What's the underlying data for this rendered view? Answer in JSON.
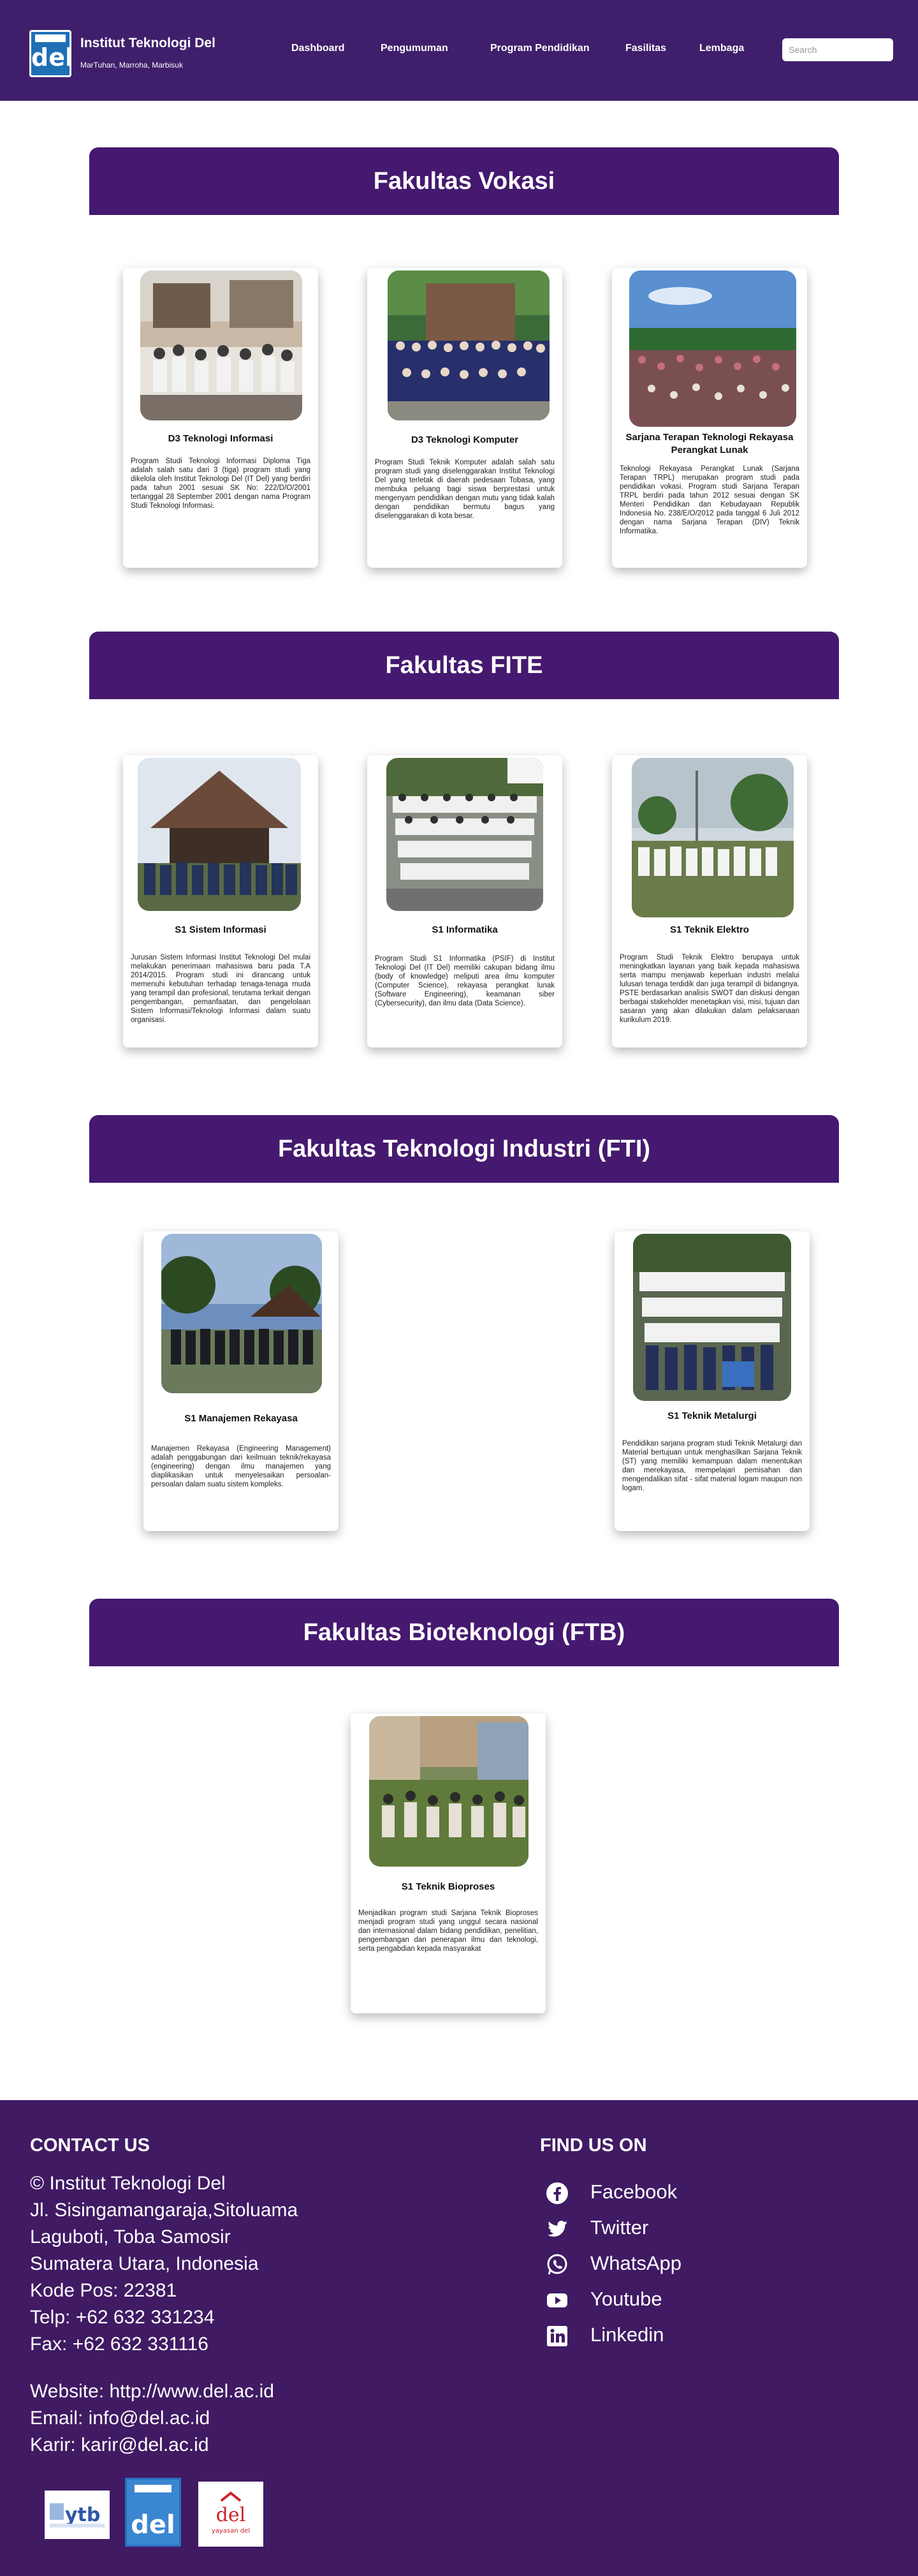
{
  "header": {
    "logo_text": "del",
    "title": "Institut Teknologi Del",
    "subtitle": "MarTuhan, Marroha, Marbisuk",
    "nav": [
      "Dashboard",
      "Pengumuman",
      "Program Pendidikan",
      "Fasilitas",
      "Lembaga"
    ],
    "search_placeholder": "Search"
  },
  "faculties": [
    {
      "name": "Fakultas Vokasi",
      "programs": [
        {
          "title": "D3 Teknologi Informasi",
          "description": "Program Studi Teknologi Informasi Diploma Tiga adalah salah satu dari 3 (tiga) program studi yang dikelola oleh Institut Teknologi Del (IT Del) yang berdiri pada tahun 2001 sesuai SK No: 222/D/O/2001 tertanggal 28 September 2001 dengan nama Program Studi Teknologi Informasi."
        },
        {
          "title": "D3 Teknologi Komputer",
          "description": "Program Studi Teknik Komputer adalah salah satu program studi yang diselenggarakan Institut Teknologi Del yang terletak di daerah pedesaan Tobasa, yang membuka peluang bagi siswa berprestasi untuk mengenyam pendidikan dengan mutu yang tidak kalah dengan pendidikan bermutu bagus yang diselenggarakan di kota besar."
        },
        {
          "title": "Sarjana Terapan Teknologi Rekayasa Perangkat Lunak",
          "description": "Teknologi Rekayasa Perangkat Lunak (Sarjana Terapan TRPL) merupakan program studi pada pendidikan vokasi. Program studi Sarjana Terapan TRPL berdiri pada tahun 2012 sesuai dengan SK Menteri Pendidikan dan Kebudayaan Republik Indonesia No. 238/E/O/2012 pada tanggal 6 Juli 2012 dengan nama Sarjana Terapan (DIV) Teknik Informatika."
        }
      ]
    },
    {
      "name": "Fakultas FITE",
      "programs": [
        {
          "title": "S1 Sistem Informasi",
          "description": "Jurusan Sistem Informasi Institut Teknologi Del mulai melakukan penerimaan mahasiswa baru pada T.A 2014/2015. Program studi ini dirancang untuk memenuhi kebutuhan terhadap tenaga-tenaga muda yang terampil dan profesional, terutama terkait dengan pengembangan, pemanfaatan, dan pengelolaan Sistem Informasi/Teknologi Informasi dalam suatu organisasi."
        },
        {
          "title": "S1 Informatika",
          "description": "Program Studi S1 Informatika (PSIF) di Institut Teknologi Del (IT Del) memiliki cakupan bidang ilmu (body of knowledge) meliputi area ilmu komputer (Computer Science), rekayasa perangkat lunak (Software Engineering), keamanan siber (Cybersecurity), dan ilmu data (Data Science)."
        },
        {
          "title": "S1 Teknik Elektro",
          "description": "Program Studi Teknik Elektro berupaya untuk meningkatkan layanan yang baik kepada mahasiswa serta mampu menjawab keperluan industri melalui lulusan tenaga terdidik dan juga terampil di bidangnya. PSTE berdasarkan analisis SWOT dan diskusi dengan berbagai stakeholder menetapkan visi, misi, tujuan dan sasaran yang akan dilakukan dalam pelaksanaan kurikulum 2019."
        }
      ]
    },
    {
      "name": "Fakultas Teknologi Industri (FTI)",
      "programs": [
        {
          "title": "S1 Manajemen Rekayasa",
          "description": "Manajemen Rekayasa (Engineering Management) adalah penggabungan dari keilmuan teknik/rekayasa (engineering) dengan ilmu manajemen yang diaplikasikan untuk menyelesaikan persoalan-persoalan dalam suatu sistem kompleks."
        },
        {
          "title": "S1 Teknik Metalurgi",
          "description": "Pendidikan sarjana program studi Teknik Metalurgi dan Material bertujuan untuk menghasilkan Sarjana Teknik (ST) yang memiliki kemampuan dalam menentukan dan merekayasa, mempelajari pemisahan dan mengendalikan sifat - sifat material logam maupun non logam."
        }
      ]
    },
    {
      "name": "Fakultas Bioteknologi (FTB)",
      "programs": [
        {
          "title": "S1 Teknik Bioproses",
          "description": "Menjadikan program studi Sarjana Teknik Bioproses menjadi program studi yang unggul secara nasional dan internasional dalam bidang pendidikan, penelitian, pengembangan dan penerapan ilmu dan teknologi, serta pengabdian kepada masyarakat"
        }
      ]
    }
  ],
  "footer": {
    "contact_heading": "CONTACT US",
    "contact_lines": [
      "© Institut Teknologi Del",
      "Jl. Sisingamangaraja,Sitoluama",
      "Laguboti, Toba Samosir",
      "Sumatera Utara, Indonesia",
      "Kode Pos: 22381",
      "Telp: +62 632 331234",
      "Fax: +62 632 331116"
    ],
    "web_lines": [
      "Website: http://www.del.ac.id",
      "Email: info@del.ac.id",
      "Karir: karir@del.ac.id"
    ],
    "find_heading": "FIND US ON",
    "social": [
      {
        "label": "Facebook",
        "icon": "facebook-icon"
      },
      {
        "label": "Twitter",
        "icon": "twitter-icon"
      },
      {
        "label": "WhatsApp",
        "icon": "whatsapp-icon"
      },
      {
        "label": "Youtube",
        "icon": "youtube-icon"
      },
      {
        "label": "Linkedin",
        "icon": "linkedin-icon"
      }
    ],
    "partner_logos": [
      {
        "name": "ytb-logo",
        "text": "ytb",
        "caption": "yayasan tobatenggara bhakti"
      },
      {
        "name": "itdel-logo",
        "text": "del"
      },
      {
        "name": "yayasan-del-logo",
        "text": "del",
        "caption": "yayasan del"
      }
    ]
  },
  "colors": {
    "primary_purple": "#45196f",
    "header_purple": "#3f1f6b",
    "footer_purple": "#401a63",
    "white": "#ffffff"
  }
}
